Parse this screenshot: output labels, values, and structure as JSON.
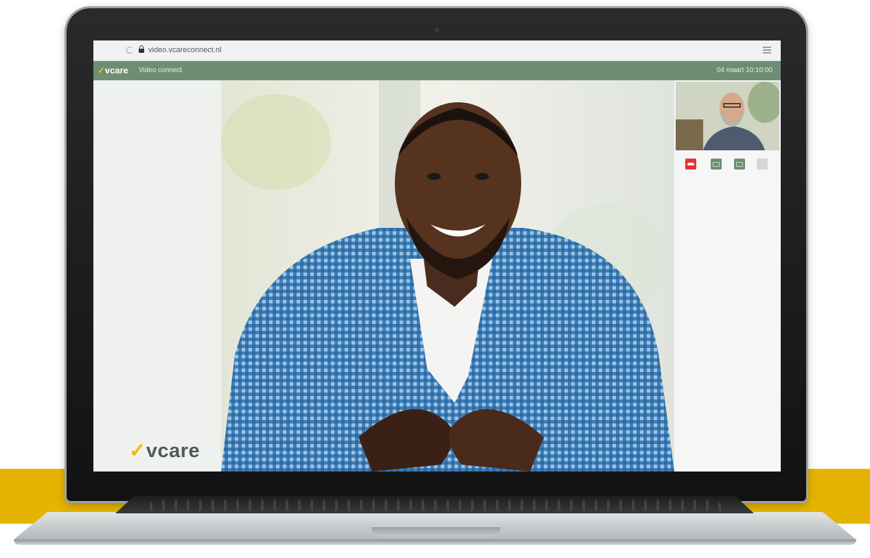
{
  "browser": {
    "url": "video.vcareconnect.nl"
  },
  "header": {
    "brand": "vcare",
    "app_title": "Video connect",
    "datetime": "04 maart 10:10:00"
  },
  "sidebar": {
    "logo": "vcare"
  },
  "call_controls": {
    "hangup_color": "#e23434",
    "mic_color": "#6e8e74",
    "camera_color": "#6e8e74",
    "more_color": "#d6d6d6"
  },
  "colors": {
    "header_green": "#6e8e74",
    "brand_yellow": "#f2b800",
    "band_yellow": "#e4b400"
  }
}
